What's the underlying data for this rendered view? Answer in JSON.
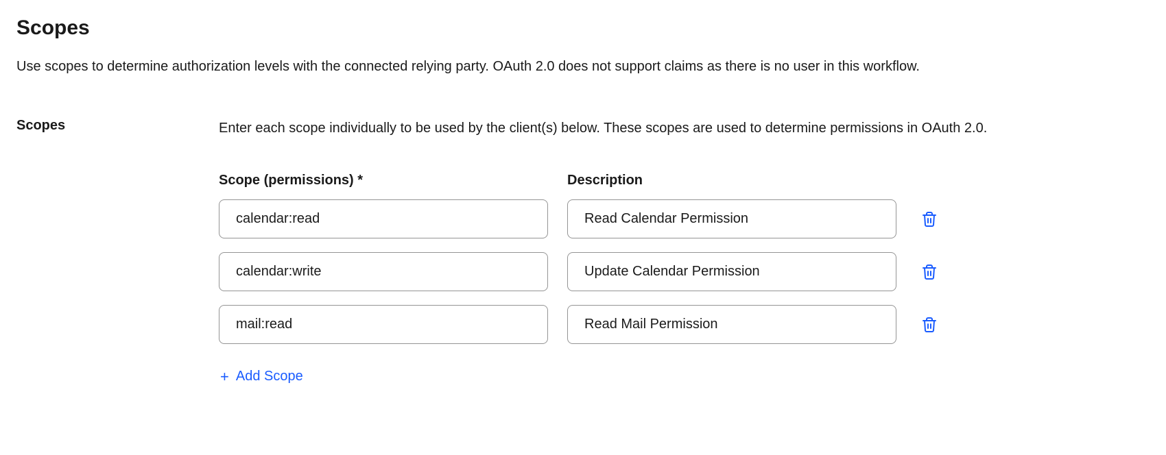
{
  "header": {
    "title": "Scopes",
    "subtitle": "Use scopes to determine authorization levels with the connected relying party. OAuth 2.0 does not support claims as there is no user in this workflow."
  },
  "section": {
    "left_label": "Scopes",
    "description": "Enter each scope individually to be used by the client(s) below. These scopes are used to determine permissions in OAuth 2.0."
  },
  "columns": {
    "scope_label": "Scope (permissions) *",
    "description_label": "Description"
  },
  "rows": [
    {
      "scope": "calendar:read",
      "description": "Read Calendar Permission"
    },
    {
      "scope": "calendar:write",
      "description": "Update Calendar Permission"
    },
    {
      "scope": "mail:read",
      "description": "Read Mail Permission"
    }
  ],
  "actions": {
    "add_scope_label": "Add Scope"
  },
  "colors": {
    "accent": "#1a5cff"
  }
}
